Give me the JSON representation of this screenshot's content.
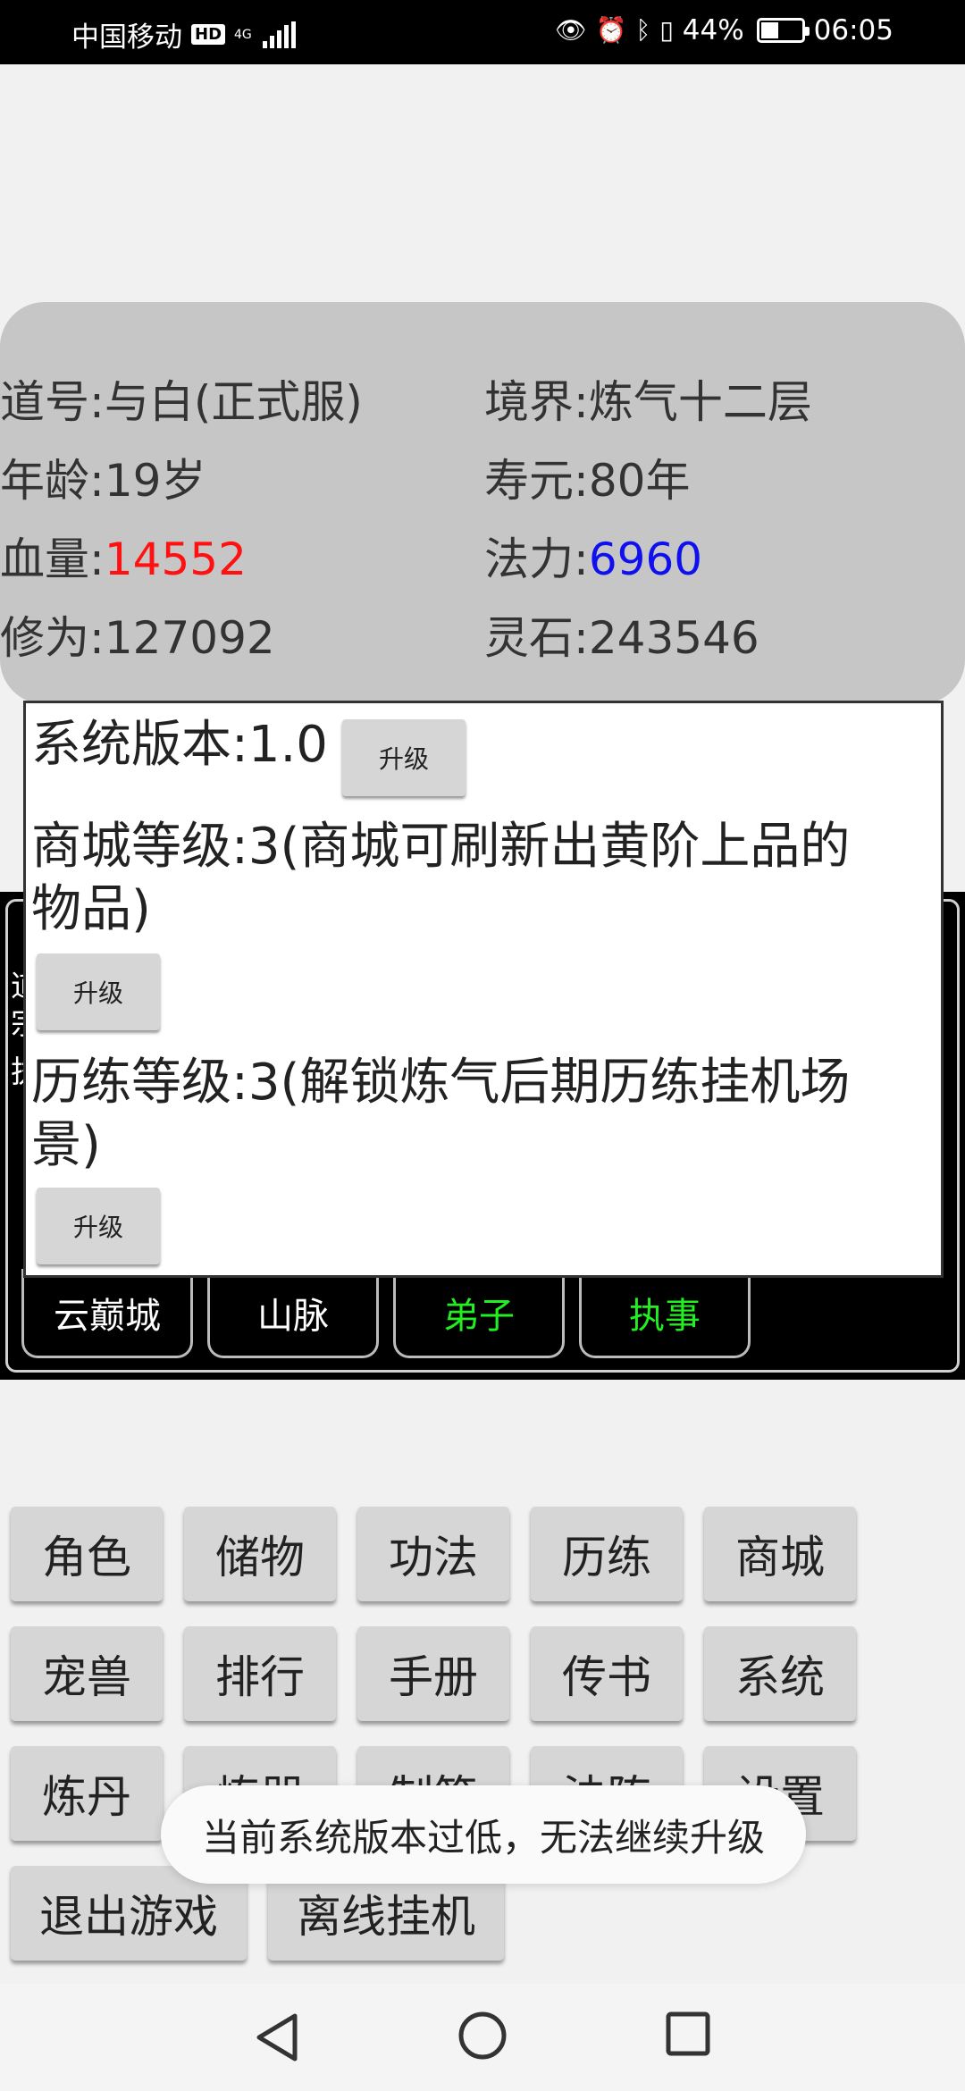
{
  "status_bar": {
    "carrier": "中国移动",
    "hd_badge": "HD",
    "network": "4G",
    "battery_percent_text": "44%",
    "battery_level": 0.44,
    "time": "06:05",
    "icons": [
      "eye-icon",
      "alarm-icon",
      "bluetooth-icon",
      "vibrate-icon",
      "battery-icon"
    ]
  },
  "stats": {
    "dao_name": "道号:与白(正式服)",
    "realm": "境界:炼气十二层",
    "age": "年龄:19岁",
    "lifespan": "寿元:80年",
    "hp_label": "血量:",
    "hp_value": "14552",
    "mana_label": "法力:",
    "mana_value": "6960",
    "cultivation": "修为:127092",
    "spirit_stones": "灵石:243546",
    "colors": {
      "hp": "#ff1111",
      "mana": "#1010ee"
    }
  },
  "dialog": {
    "system_version": "系统版本:1.0",
    "upgrade_label": "升级",
    "shop_level_line1": "商城等级:3(商城可刷新出黄阶上品的",
    "shop_level_line2": "物品)",
    "training_level_line1": "历练等级:3(解锁炼气后期历练挂机场",
    "training_level_line2": "景)"
  },
  "location_tabs": [
    {
      "label": "云巅城",
      "color": "#ffffff"
    },
    {
      "label": "山脉",
      "color": "#ffffff"
    },
    {
      "label": "弟子",
      "color": "#22ee22"
    },
    {
      "label": "执事",
      "color": "#22ee22"
    }
  ],
  "peek_text": [
    "道",
    "宗",
    "执"
  ],
  "menu": {
    "row1": [
      "角色",
      "储物",
      "功法",
      "历练",
      "商城"
    ],
    "row2": [
      "宠兽",
      "排行",
      "手册",
      "传书",
      "系统"
    ],
    "row3": [
      "炼丹",
      "炼器",
      "制符",
      "法阵",
      "设置"
    ],
    "row4": [
      "退出游戏",
      "离线挂机"
    ]
  },
  "toast": "当前系统版本过低，无法继续升级",
  "nav": [
    "back-icon",
    "home-icon",
    "recents-icon"
  ]
}
